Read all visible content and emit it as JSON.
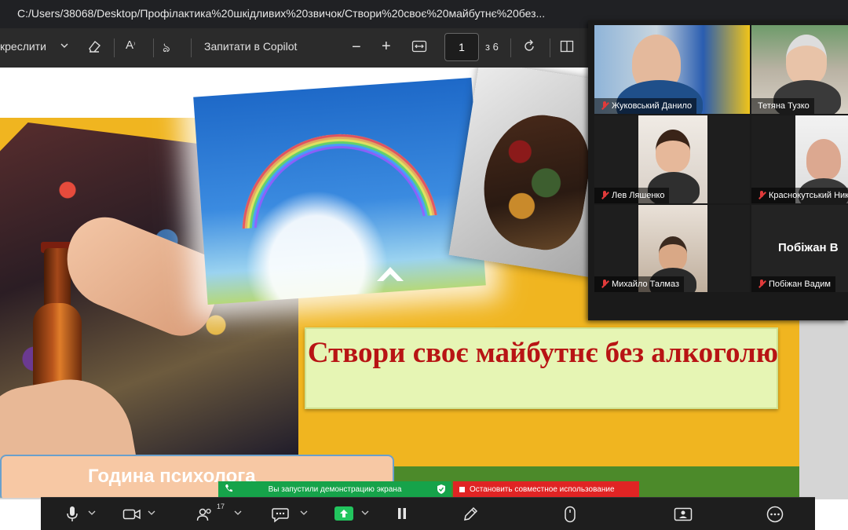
{
  "browser": {
    "url": "C:/Users/38068/Desktop/Профілактика%20шкідливих%20звичок/Створи%20своє%20майбутнє%20без..."
  },
  "toolbar": {
    "draw_label": "креслити",
    "copilot_label": "Запитати в Copilot",
    "page_current": "1",
    "page_total": "з 6"
  },
  "slide": {
    "title": "Створи своє майбутнє без алкоголю",
    "caption": "Година психолога"
  },
  "gallery": {
    "participants": [
      {
        "name": "Жуковський Данило",
        "muted": true
      },
      {
        "name": "Тетяна Тузко",
        "muted": false
      },
      {
        "name": "Лев Ляшенко",
        "muted": true
      },
      {
        "name": "Краснокутський Ник",
        "muted": true
      },
      {
        "name": "Михайло Талмаз",
        "muted": true
      },
      {
        "name": "Побіжан Вадим",
        "muted": true
      }
    ],
    "video_off_label": "Побіжан В"
  },
  "share": {
    "status": "Вы запустили демонстрацию экрана",
    "stop_label": "Остановить совместное использование"
  },
  "zoom": {
    "participants_count": "17"
  },
  "colors": {
    "slide_yellow": "#f0b520",
    "title_red": "#b81414",
    "share_green": "#16a34a",
    "share_red": "#e02424"
  }
}
